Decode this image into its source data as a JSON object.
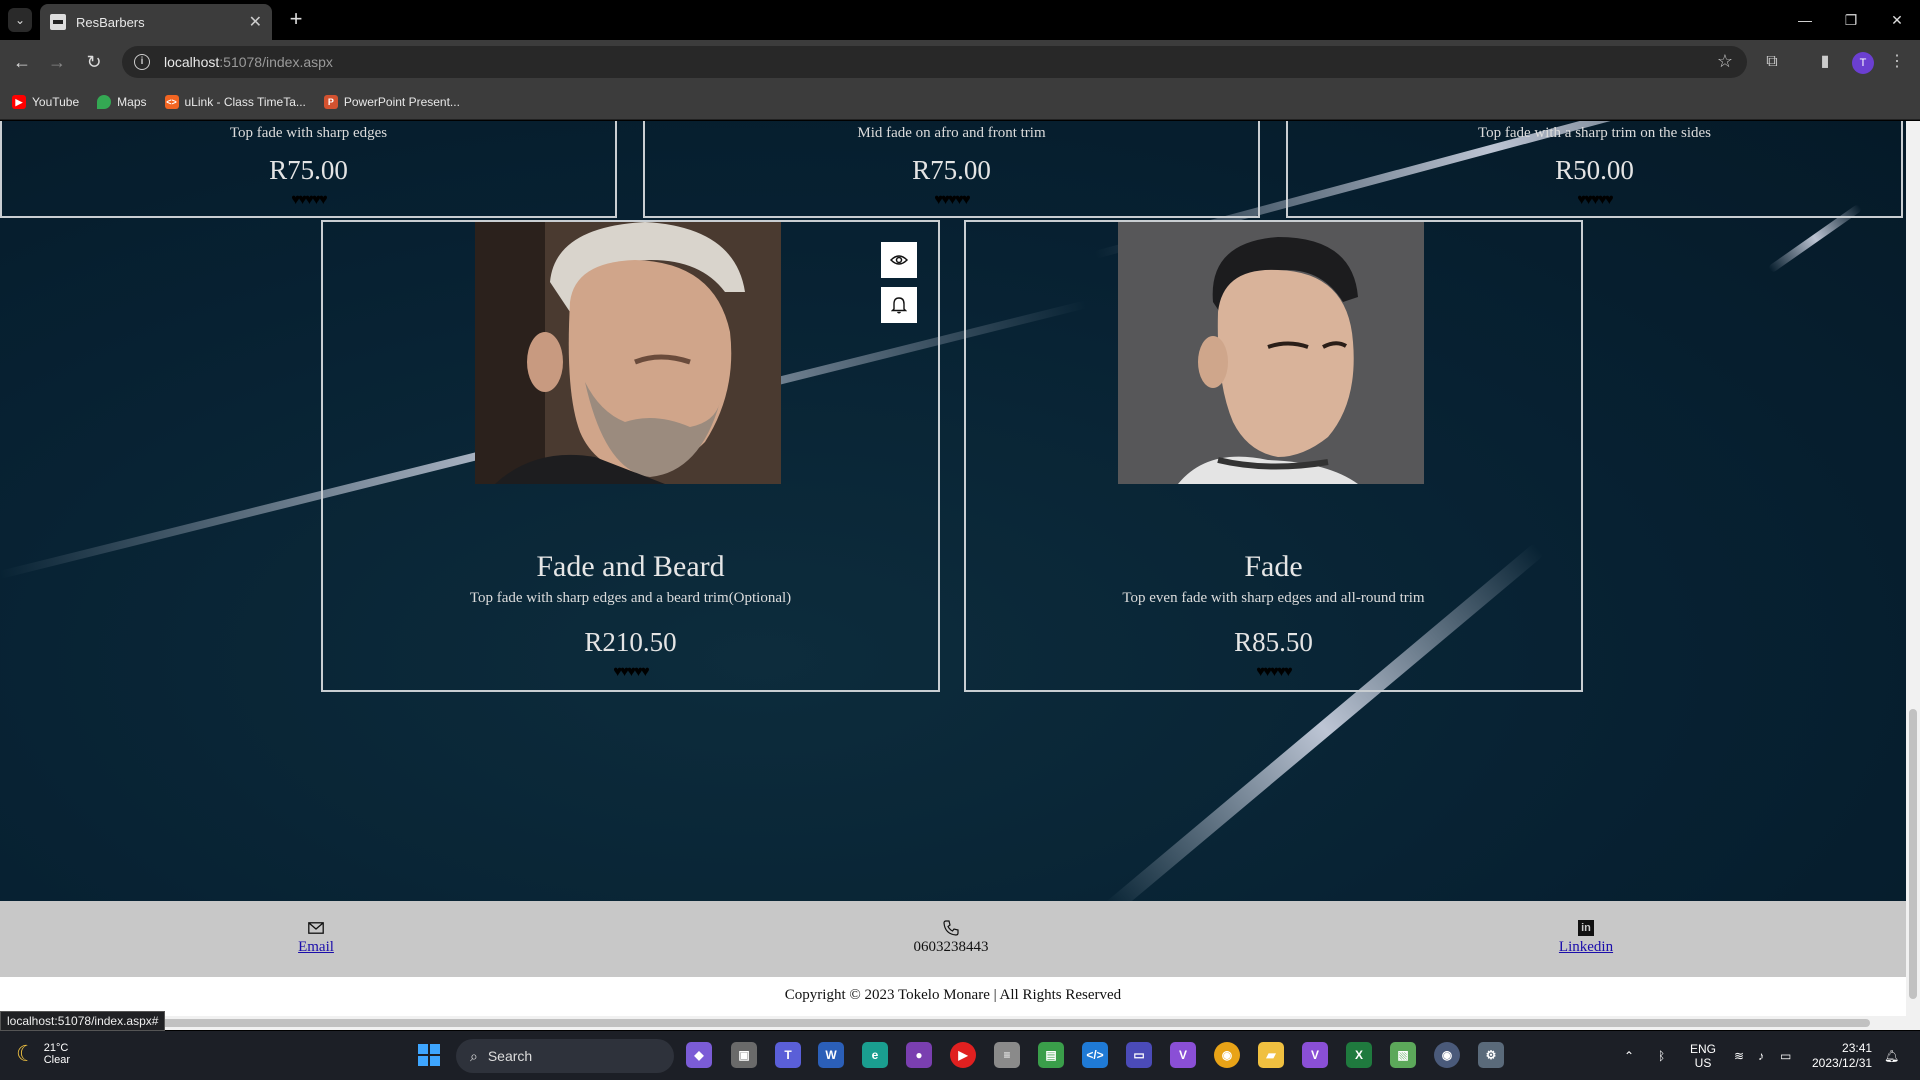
{
  "browser": {
    "tab_title": "ResBarbers",
    "tab_close": "✕",
    "new_tab": "+",
    "url_host": "localhost",
    "url_rest": ":51078/index.aspx",
    "status_url": "localhost:51078/index.aspx#",
    "avatar_initial": "T",
    "bookmarks": [
      {
        "label": "YouTube",
        "icon": "youtube-icon",
        "color": "#ff0000"
      },
      {
        "label": "Maps",
        "icon": "maps-icon",
        "color": "#34a853"
      },
      {
        "label": "uLink - Class TimeTa...",
        "icon": "ulink-icon",
        "color": "#f26522"
      },
      {
        "label": "PowerPoint Present...",
        "icon": "powerpoint-icon",
        "color": "#d35230"
      }
    ]
  },
  "top_cards": [
    {
      "desc": "Top fade with sharp edges",
      "price": "R75.00",
      "stars": "♥♥♥♥♥"
    },
    {
      "desc": "Mid fade on afro and front trim",
      "price": "R75.00",
      "stars": "♥♥♥♥♥"
    },
    {
      "desc": "Top fade with a sharp trim on the sides",
      "price": "R50.00",
      "stars": "♥♥♥♥♥"
    }
  ],
  "services": [
    {
      "name": "Fade and Beard",
      "desc": "Top fade with sharp edges and a beard trim(Optional)",
      "price": "R210.50",
      "stars": "♥♥♥♥♥",
      "photo": "bearded-man-portrait"
    },
    {
      "name": "Fade",
      "desc": "Top even fade with sharp edges and all-round trim",
      "price": "R85.50",
      "stars": "♥♥♥♥♥",
      "photo": "young-man-portrait"
    }
  ],
  "footer": {
    "email_label": "Email",
    "phone": "0603238443",
    "linkedin_label": "Linkedin",
    "copyright": "Copyright © 2023 Tokelo Monare | All Rights Reserved"
  },
  "taskbar": {
    "temperature": "21°C",
    "weather": "Clear",
    "search_label": "Search",
    "lang_top": "ENG",
    "lang_bottom": "US",
    "time": "23:41",
    "date": "2023/12/31"
  },
  "colors": {
    "page_bg": "#072132",
    "card_border": "#c9ced2",
    "footer_bg": "#c8c8c8",
    "link": "#1a0dab"
  }
}
